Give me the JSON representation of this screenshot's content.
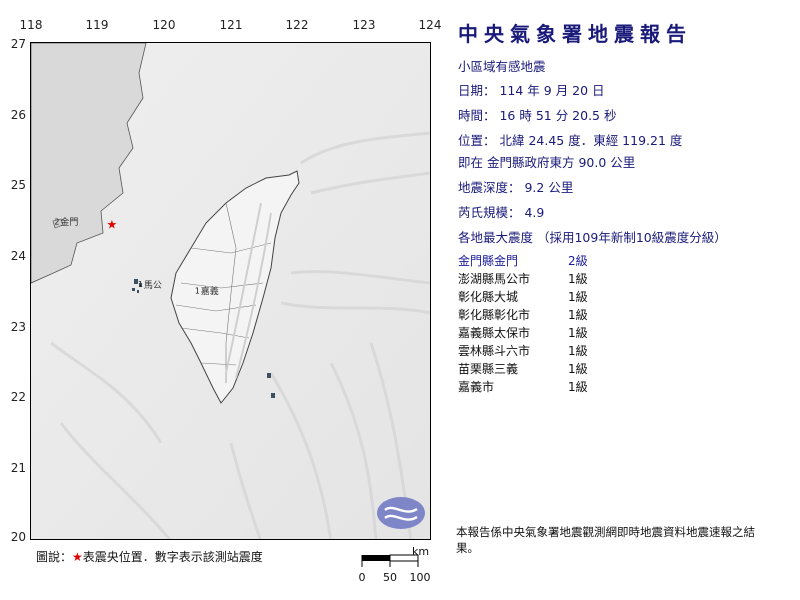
{
  "report": {
    "title": "中央氣象署地震報告",
    "type": "小區域有感地震",
    "date": "日期： 114 年 9 月 20 日",
    "time": "時間： 16 時 51 分 20.5 秒",
    "location": "位置： 北緯 24.45 度．東經 119.21 度",
    "relative": "即在 金門縣政府東方 90.0 公里",
    "depth": "地震深度： 9.2 公里",
    "magnitude": "芮氏規模： 4.9",
    "intensity_title": "各地最大震度 （採用109年新制10級震度分級）",
    "stations": [
      {
        "name": "金門縣金門",
        "level": "2級"
      },
      {
        "name": "澎湖縣馬公市",
        "level": "1級"
      },
      {
        "name": "彰化縣大城",
        "level": "1級"
      },
      {
        "name": "彰化縣彰化市",
        "level": "1級"
      },
      {
        "name": "嘉義縣太保市",
        "level": "1級"
      },
      {
        "name": "雲林縣斗六市",
        "level": "1級"
      },
      {
        "name": "苗栗縣三義",
        "level": "1級"
      },
      {
        "name": "嘉義市",
        "level": "1級"
      }
    ],
    "note": "本報告係中央氣象署地震觀測網即時地震資料地震速報之結果。"
  },
  "map": {
    "x_ticks": [
      "118",
      "119",
      "120",
      "121",
      "122",
      "123",
      "124"
    ],
    "y_ticks": [
      "27",
      "26",
      "25",
      "24",
      "23",
      "22",
      "21",
      "20"
    ],
    "lon_range": [
      118,
      124
    ],
    "lat_range": [
      20,
      27
    ],
    "epicenter": {
      "lon": 119.21,
      "lat": 24.45
    },
    "station_labels": [
      {
        "text": "金門",
        "lon": 118.35,
        "lat": 24.45,
        "marker": "2"
      },
      {
        "text": "馬公",
        "lon": 119.6,
        "lat": 23.57,
        "marker": "1"
      },
      {
        "text": "嘉義",
        "lon": 120.45,
        "lat": 23.48,
        "marker": "1"
      }
    ]
  },
  "legend": {
    "prefix": "圖說：",
    "star": "★",
    "text": "表震央位置．數字表示該測站震度"
  },
  "scale": {
    "unit": "km",
    "labels": [
      "0",
      "50",
      "100"
    ]
  },
  "colors": {
    "title": "#1a1a7a",
    "epicenter": "#e00000",
    "land": "#dcdcdc",
    "taiwan": "#f6f6f6"
  }
}
